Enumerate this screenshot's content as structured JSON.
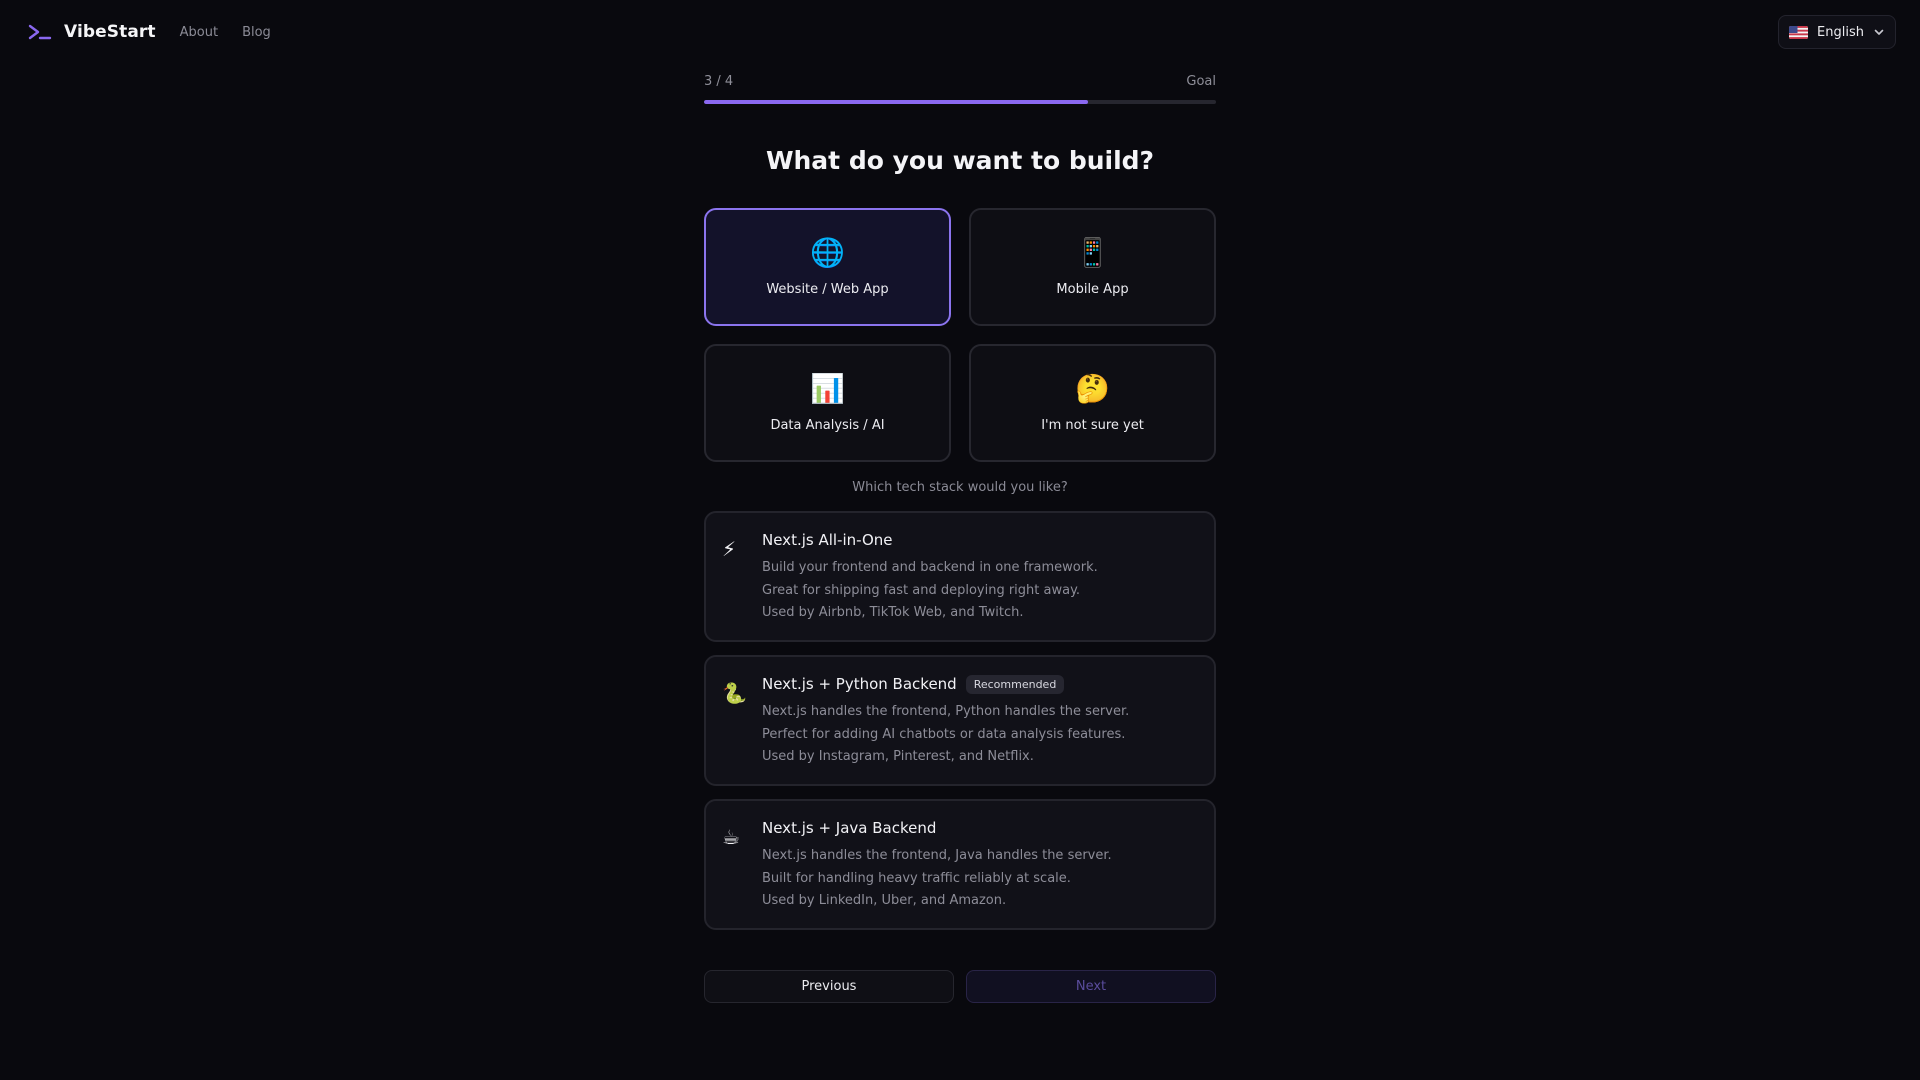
{
  "header": {
    "brand": "VibeStart",
    "nav": [
      "About",
      "Blog"
    ],
    "language": "English",
    "brand_color": "#8a68f0"
  },
  "progress": {
    "step_label": "3 / 4",
    "section_label": "Goal",
    "fraction": 0.75
  },
  "question": {
    "title": "What do you want to build?"
  },
  "choices": [
    {
      "icon": "🌐",
      "icon_name": "globe-icon",
      "label": "Website / Web App",
      "selected": true
    },
    {
      "icon": "📱",
      "icon_name": "mobile-phone-icon",
      "label": "Mobile App",
      "selected": false
    },
    {
      "icon": "📊",
      "icon_name": "bar-chart-icon",
      "label": "Data Analysis / AI",
      "selected": false
    },
    {
      "icon": "🤔",
      "icon_name": "thinking-face-icon",
      "label": "I'm not sure yet",
      "selected": false
    }
  ],
  "stack": {
    "question": "Which tech stack would you like?",
    "options": [
      {
        "icon": "⚡",
        "icon_name": "lightning-icon",
        "title": "Next.js All-in-One",
        "badge": "",
        "lines": [
          "Build your frontend and backend in one framework.",
          "Great for shipping fast and deploying right away.",
          "Used by Airbnb, TikTok Web, and Twitch."
        ]
      },
      {
        "icon": "🐍",
        "icon_name": "snake-icon",
        "title": "Next.js + Python Backend",
        "badge": "Recommended",
        "lines": [
          "Next.js handles the frontend, Python handles the server.",
          "Perfect for adding AI chatbots or data analysis features.",
          "Used by Instagram, Pinterest, and Netflix."
        ]
      },
      {
        "icon": "☕",
        "icon_name": "coffee-icon",
        "title": "Next.js + Java Backend",
        "badge": "",
        "lines": [
          "Next.js handles the frontend, Java handles the server.",
          "Built for handling heavy traffic reliably at scale.",
          "Used by LinkedIn, Uber, and Amazon."
        ]
      }
    ]
  },
  "buttons": {
    "previous": "Previous",
    "next": "Next"
  }
}
